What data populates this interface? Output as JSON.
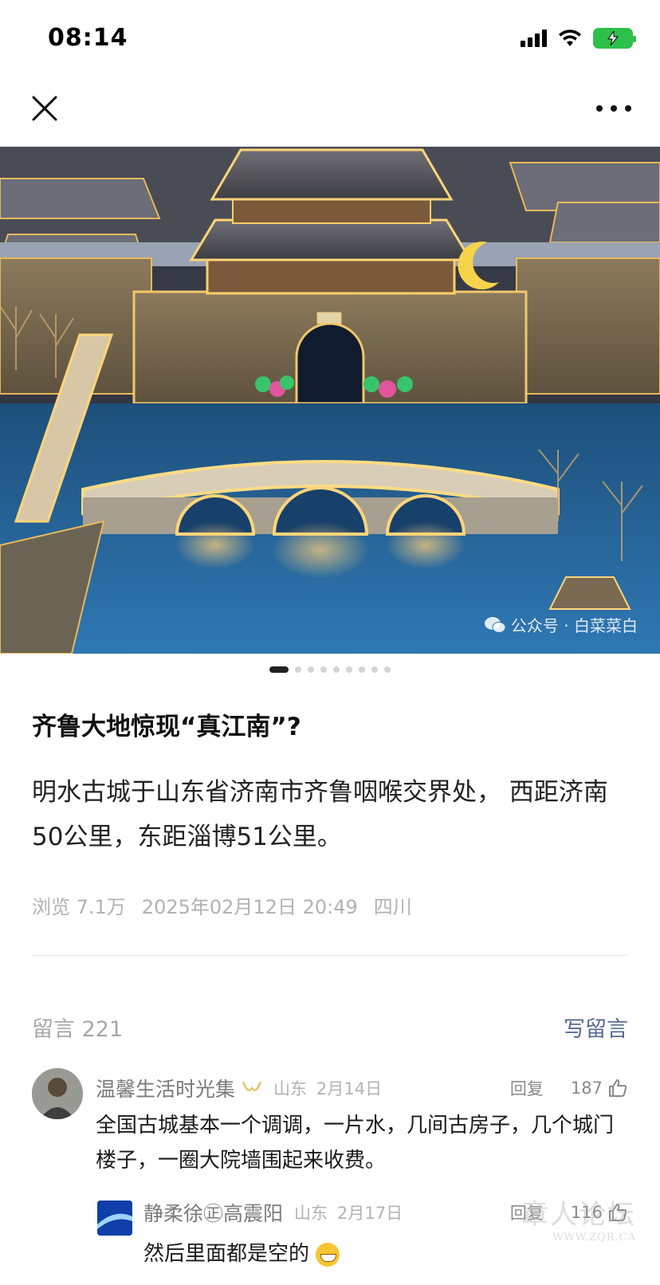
{
  "status_bar": {
    "time": "08:14"
  },
  "image": {
    "watermark": "公众号 · 白菜菜白",
    "carousel": {
      "total": 9,
      "current": 1
    }
  },
  "article": {
    "title": "齐鲁大地惊现“真江南”?",
    "body": "明水古城于山东省济南市齐鲁咽喉交界处， 西距济南50公里，东距淄博51公里。",
    "meta": {
      "views": "浏览 7.1万",
      "datetime": "2025年02月12日 20:49",
      "location": "四川"
    }
  },
  "comments_section": {
    "count_label": "留言 221",
    "write_label": "写留言",
    "comments": [
      {
        "author": "温馨生活时光集",
        "location": "山东",
        "date": "2月14日",
        "reply_label": "回复",
        "likes": "187",
        "text": "全国古城基本一个调调，一片水，几间古房子，几个城门楼子，一圈大院墙围起来收费。",
        "replies": [
          {
            "author": "静柔徐㊣高震阳",
            "location": "山东",
            "date": "2月17日",
            "reply_label": "回复",
            "likes": "116",
            "text": "然后里面都是空的"
          }
        ]
      }
    ]
  },
  "overlay_watermark": {
    "text": "章人论坛",
    "url": "WWW.ZQR.CA"
  }
}
